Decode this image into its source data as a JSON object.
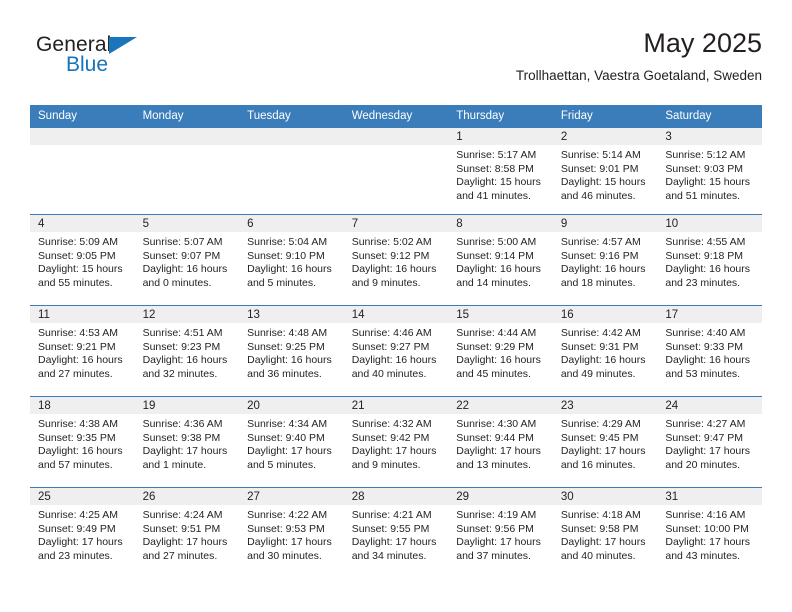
{
  "brand": {
    "name_part1": "General",
    "name_part2": "Blue",
    "triangle_color": "#1b75bb",
    "blue_text_color": "#1574bb"
  },
  "header": {
    "title": "May 2025",
    "subtitle": "Trollhaettan, Vaestra Goetaland, Sweden",
    "header_bg_color": "#3a7dba",
    "daynum_bg_color": "#efefef"
  },
  "weekday_headers": [
    "Sunday",
    "Monday",
    "Tuesday",
    "Wednesday",
    "Thursday",
    "Friday",
    "Saturday"
  ],
  "labels": {
    "sunrise_prefix": "Sunrise:",
    "sunset_prefix": "Sunset:",
    "daylight_prefix": "Daylight:"
  },
  "weeks": [
    [
      {
        "day": "",
        "empty": true
      },
      {
        "day": "",
        "empty": true
      },
      {
        "day": "",
        "empty": true
      },
      {
        "day": "",
        "empty": true
      },
      {
        "day": "1",
        "sunrise": "Sunrise: 5:17 AM",
        "sunset": "Sunset: 8:58 PM",
        "daylight_line1": "Daylight: 15 hours",
        "daylight_line2": "and 41 minutes."
      },
      {
        "day": "2",
        "sunrise": "Sunrise: 5:14 AM",
        "sunset": "Sunset: 9:01 PM",
        "daylight_line1": "Daylight: 15 hours",
        "daylight_line2": "and 46 minutes."
      },
      {
        "day": "3",
        "sunrise": "Sunrise: 5:12 AM",
        "sunset": "Sunset: 9:03 PM",
        "daylight_line1": "Daylight: 15 hours",
        "daylight_line2": "and 51 minutes."
      }
    ],
    [
      {
        "day": "4",
        "sunrise": "Sunrise: 5:09 AM",
        "sunset": "Sunset: 9:05 PM",
        "daylight_line1": "Daylight: 15 hours",
        "daylight_line2": "and 55 minutes."
      },
      {
        "day": "5",
        "sunrise": "Sunrise: 5:07 AM",
        "sunset": "Sunset: 9:07 PM",
        "daylight_line1": "Daylight: 16 hours",
        "daylight_line2": "and 0 minutes."
      },
      {
        "day": "6",
        "sunrise": "Sunrise: 5:04 AM",
        "sunset": "Sunset: 9:10 PM",
        "daylight_line1": "Daylight: 16 hours",
        "daylight_line2": "and 5 minutes."
      },
      {
        "day": "7",
        "sunrise": "Sunrise: 5:02 AM",
        "sunset": "Sunset: 9:12 PM",
        "daylight_line1": "Daylight: 16 hours",
        "daylight_line2": "and 9 minutes."
      },
      {
        "day": "8",
        "sunrise": "Sunrise: 5:00 AM",
        "sunset": "Sunset: 9:14 PM",
        "daylight_line1": "Daylight: 16 hours",
        "daylight_line2": "and 14 minutes."
      },
      {
        "day": "9",
        "sunrise": "Sunrise: 4:57 AM",
        "sunset": "Sunset: 9:16 PM",
        "daylight_line1": "Daylight: 16 hours",
        "daylight_line2": "and 18 minutes."
      },
      {
        "day": "10",
        "sunrise": "Sunrise: 4:55 AM",
        "sunset": "Sunset: 9:18 PM",
        "daylight_line1": "Daylight: 16 hours",
        "daylight_line2": "and 23 minutes."
      }
    ],
    [
      {
        "day": "11",
        "sunrise": "Sunrise: 4:53 AM",
        "sunset": "Sunset: 9:21 PM",
        "daylight_line1": "Daylight: 16 hours",
        "daylight_line2": "and 27 minutes."
      },
      {
        "day": "12",
        "sunrise": "Sunrise: 4:51 AM",
        "sunset": "Sunset: 9:23 PM",
        "daylight_line1": "Daylight: 16 hours",
        "daylight_line2": "and 32 minutes."
      },
      {
        "day": "13",
        "sunrise": "Sunrise: 4:48 AM",
        "sunset": "Sunset: 9:25 PM",
        "daylight_line1": "Daylight: 16 hours",
        "daylight_line2": "and 36 minutes."
      },
      {
        "day": "14",
        "sunrise": "Sunrise: 4:46 AM",
        "sunset": "Sunset: 9:27 PM",
        "daylight_line1": "Daylight: 16 hours",
        "daylight_line2": "and 40 minutes."
      },
      {
        "day": "15",
        "sunrise": "Sunrise: 4:44 AM",
        "sunset": "Sunset: 9:29 PM",
        "daylight_line1": "Daylight: 16 hours",
        "daylight_line2": "and 45 minutes."
      },
      {
        "day": "16",
        "sunrise": "Sunrise: 4:42 AM",
        "sunset": "Sunset: 9:31 PM",
        "daylight_line1": "Daylight: 16 hours",
        "daylight_line2": "and 49 minutes."
      },
      {
        "day": "17",
        "sunrise": "Sunrise: 4:40 AM",
        "sunset": "Sunset: 9:33 PM",
        "daylight_line1": "Daylight: 16 hours",
        "daylight_line2": "and 53 minutes."
      }
    ],
    [
      {
        "day": "18",
        "sunrise": "Sunrise: 4:38 AM",
        "sunset": "Sunset: 9:35 PM",
        "daylight_line1": "Daylight: 16 hours",
        "daylight_line2": "and 57 minutes."
      },
      {
        "day": "19",
        "sunrise": "Sunrise: 4:36 AM",
        "sunset": "Sunset: 9:38 PM",
        "daylight_line1": "Daylight: 17 hours",
        "daylight_line2": "and 1 minute."
      },
      {
        "day": "20",
        "sunrise": "Sunrise: 4:34 AM",
        "sunset": "Sunset: 9:40 PM",
        "daylight_line1": "Daylight: 17 hours",
        "daylight_line2": "and 5 minutes."
      },
      {
        "day": "21",
        "sunrise": "Sunrise: 4:32 AM",
        "sunset": "Sunset: 9:42 PM",
        "daylight_line1": "Daylight: 17 hours",
        "daylight_line2": "and 9 minutes."
      },
      {
        "day": "22",
        "sunrise": "Sunrise: 4:30 AM",
        "sunset": "Sunset: 9:44 PM",
        "daylight_line1": "Daylight: 17 hours",
        "daylight_line2": "and 13 minutes."
      },
      {
        "day": "23",
        "sunrise": "Sunrise: 4:29 AM",
        "sunset": "Sunset: 9:45 PM",
        "daylight_line1": "Daylight: 17 hours",
        "daylight_line2": "and 16 minutes."
      },
      {
        "day": "24",
        "sunrise": "Sunrise: 4:27 AM",
        "sunset": "Sunset: 9:47 PM",
        "daylight_line1": "Daylight: 17 hours",
        "daylight_line2": "and 20 minutes."
      }
    ],
    [
      {
        "day": "25",
        "sunrise": "Sunrise: 4:25 AM",
        "sunset": "Sunset: 9:49 PM",
        "daylight_line1": "Daylight: 17 hours",
        "daylight_line2": "and 23 minutes."
      },
      {
        "day": "26",
        "sunrise": "Sunrise: 4:24 AM",
        "sunset": "Sunset: 9:51 PM",
        "daylight_line1": "Daylight: 17 hours",
        "daylight_line2": "and 27 minutes."
      },
      {
        "day": "27",
        "sunrise": "Sunrise: 4:22 AM",
        "sunset": "Sunset: 9:53 PM",
        "daylight_line1": "Daylight: 17 hours",
        "daylight_line2": "and 30 minutes."
      },
      {
        "day": "28",
        "sunrise": "Sunrise: 4:21 AM",
        "sunset": "Sunset: 9:55 PM",
        "daylight_line1": "Daylight: 17 hours",
        "daylight_line2": "and 34 minutes."
      },
      {
        "day": "29",
        "sunrise": "Sunrise: 4:19 AM",
        "sunset": "Sunset: 9:56 PM",
        "daylight_line1": "Daylight: 17 hours",
        "daylight_line2": "and 37 minutes."
      },
      {
        "day": "30",
        "sunrise": "Sunrise: 4:18 AM",
        "sunset": "Sunset: 9:58 PM",
        "daylight_line1": "Daylight: 17 hours",
        "daylight_line2": "and 40 minutes."
      },
      {
        "day": "31",
        "sunrise": "Sunrise: 4:16 AM",
        "sunset": "Sunset: 10:00 PM",
        "daylight_line1": "Daylight: 17 hours",
        "daylight_line2": "and 43 minutes."
      }
    ]
  ]
}
